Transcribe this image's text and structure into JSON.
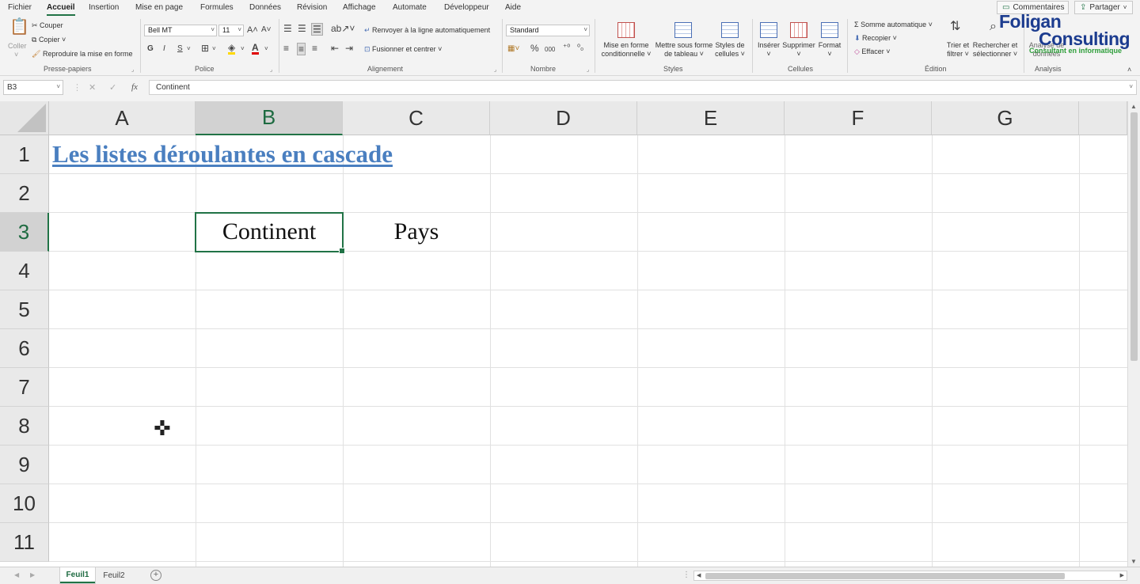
{
  "menu_tabs": [
    "Fichier",
    "Accueil",
    "Insertion",
    "Mise en page",
    "Formules",
    "Données",
    "Révision",
    "Affichage",
    "Automate",
    "Développeur",
    "Aide"
  ],
  "top_buttons": {
    "comments": "Commentaires",
    "share": "Partager"
  },
  "watermark": {
    "line1": "Foligan",
    "line2": "Consulting",
    "line3": "Consultant en informatique"
  },
  "ribbon": {
    "clipboard": {
      "paste": "Coller",
      "cut": "Couper",
      "copy": "Copier",
      "format_painter": "Reproduire la mise en forme",
      "group": "Presse-papiers"
    },
    "font": {
      "name": "Bell MT",
      "size": "11",
      "bold": "G",
      "italic": "I",
      "underline": "S",
      "group": "Police"
    },
    "alignment": {
      "wrap": "Renvoyer à la ligne automatiquement",
      "merge": "Fusionner et centrer",
      "group": "Alignement"
    },
    "number": {
      "format": "Standard",
      "percent": "%",
      "thousands": "000",
      "group": "Nombre"
    },
    "styles": {
      "conditional": [
        "Mise en forme",
        "conditionnelle ˅"
      ],
      "as_table": [
        "Mettre sous forme",
        "de tableau ˅"
      ],
      "cell_styles": [
        "Styles de",
        "cellules ˅"
      ],
      "group": "Styles"
    },
    "cells": {
      "insert": "Insérer",
      "delete": "Supprimer",
      "format": "Format",
      "group": "Cellules"
    },
    "editing": {
      "autosum": "Somme automatique",
      "fill": "Recopier",
      "clear": "Effacer",
      "sort": [
        "Trier et",
        "filtrer ˅"
      ],
      "find": [
        "Rechercher et",
        "sélectionner ˅"
      ],
      "group": "Édition"
    },
    "analysis": {
      "analyze": [
        "Analyse de",
        "données"
      ],
      "group": "Analysis"
    }
  },
  "formula_bar": {
    "name_box": "B3",
    "fx": "fx",
    "content": "Continent"
  },
  "columns": [
    "A",
    "B",
    "C",
    "D",
    "E",
    "F",
    "G"
  ],
  "rows": [
    "1",
    "2",
    "3",
    "4",
    "5",
    "6",
    "7",
    "8",
    "9",
    "10",
    "11"
  ],
  "cells": {
    "A1": "Les listes déroulantes en cascade",
    "B3": "Continent",
    "C3": "Pays"
  },
  "selected": {
    "column": "B",
    "row": "3"
  },
  "sheets": [
    {
      "name": "Feuil1",
      "active": true
    },
    {
      "name": "Feuil2",
      "active": false
    }
  ],
  "colors": {
    "accent": "#217346",
    "title": "#4a7fc0",
    "watermark_blue": "#1c3c8f",
    "watermark_green": "#2e9e3a"
  }
}
